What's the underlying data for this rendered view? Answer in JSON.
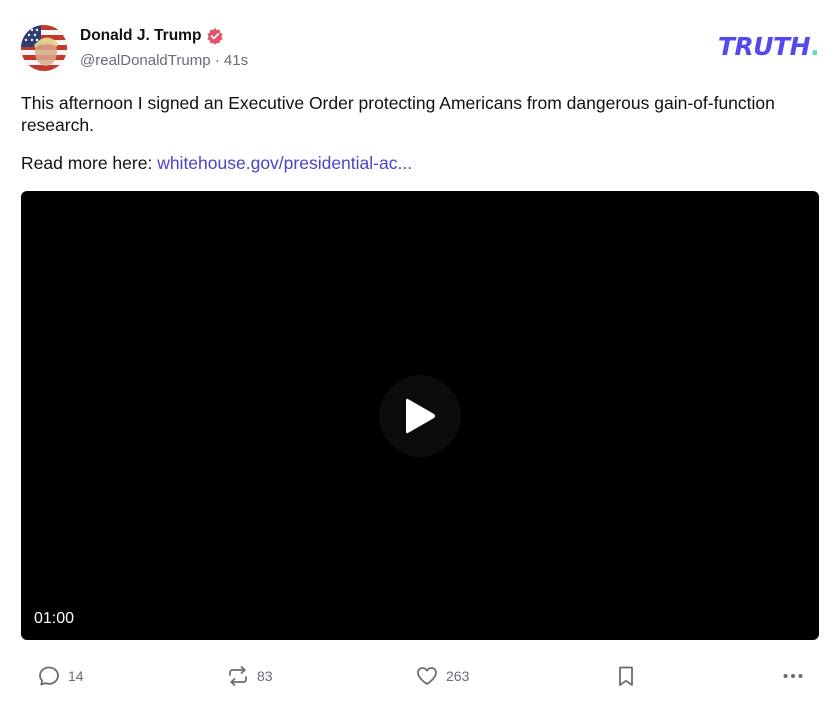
{
  "post": {
    "author": {
      "display_name": "Donald J. Trump",
      "handle": "@realDonaldTrump",
      "separator": "·",
      "timestamp": "41s",
      "verified": true
    },
    "brand": {
      "text": "TRUTH",
      "dot": "."
    },
    "body": {
      "line1": "This afternoon I signed an Executive Order protecting Americans from dangerous gain-of-function research.",
      "read_more_prefix": "Read more here: ",
      "link_text": "whitehouse.gov/presidential-ac..."
    },
    "video": {
      "duration": "01:00"
    },
    "actions": {
      "replies": "14",
      "retruths": "83",
      "likes": "263"
    }
  },
  "colors": {
    "brand_purple": "#5448ee",
    "brand_teal": "#5ad8cc",
    "link": "#4a44c6",
    "verified": "#e5556a",
    "muted": "#6b6b76"
  },
  "icons": [
    "verified-badge-icon",
    "play-icon",
    "reply-icon",
    "retruth-icon",
    "like-icon",
    "bookmark-icon",
    "more-icon"
  ]
}
